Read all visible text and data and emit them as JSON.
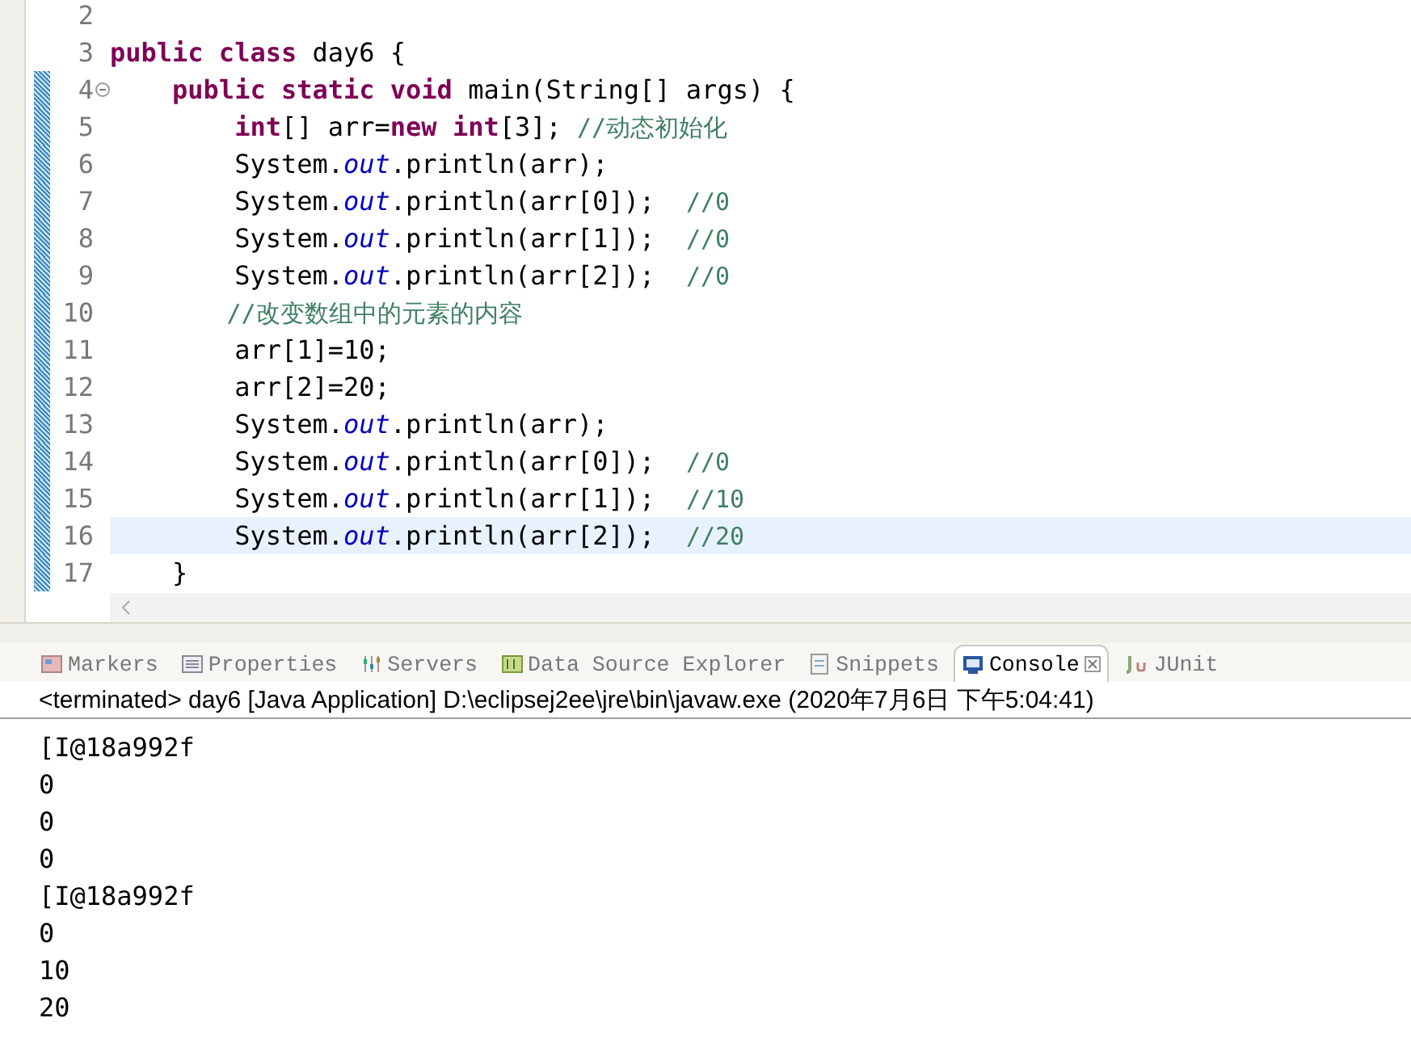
{
  "editor": {
    "lines": [
      {
        "number": "2",
        "changed": false,
        "current": false,
        "foldable": false
      },
      {
        "number": "3",
        "changed": false,
        "current": false,
        "foldable": false,
        "tokens": [
          {
            "text": "public class ",
            "kind": "keyword"
          },
          {
            "text": "day6 {",
            "kind": "plain"
          }
        ]
      },
      {
        "number": "4",
        "changed": true,
        "current": false,
        "foldable": true,
        "tokens": [
          {
            "text": "    public static void ",
            "kind": "keyword"
          },
          {
            "text": "main(String[] args) {",
            "kind": "plain"
          }
        ]
      },
      {
        "number": "5",
        "changed": true,
        "current": false,
        "foldable": false,
        "tokens": [
          {
            "text": "        int",
            "kind": "keyword"
          },
          {
            "text": "[] arr=",
            "kind": "plain"
          },
          {
            "text": "new int",
            "kind": "keyword"
          },
          {
            "text": "[3]; ",
            "kind": "plain"
          },
          {
            "text": "//动态初始化",
            "kind": "comment"
          }
        ]
      },
      {
        "number": "6",
        "changed": true,
        "current": false,
        "foldable": false,
        "tokens": [
          {
            "text": "        System.",
            "kind": "plain"
          },
          {
            "text": "out",
            "kind": "field"
          },
          {
            "text": ".println(arr);",
            "kind": "plain"
          }
        ]
      },
      {
        "number": "7",
        "changed": true,
        "current": false,
        "foldable": false,
        "tokens": [
          {
            "text": "        System.",
            "kind": "plain"
          },
          {
            "text": "out",
            "kind": "field"
          },
          {
            "text": ".println(arr[0]);  ",
            "kind": "plain"
          },
          {
            "text": "//0",
            "kind": "comment"
          }
        ]
      },
      {
        "number": "8",
        "changed": true,
        "current": false,
        "foldable": false,
        "tokens": [
          {
            "text": "        System.",
            "kind": "plain"
          },
          {
            "text": "out",
            "kind": "field"
          },
          {
            "text": ".println(arr[1]);  ",
            "kind": "plain"
          },
          {
            "text": "//0",
            "kind": "comment"
          }
        ]
      },
      {
        "number": "9",
        "changed": true,
        "current": false,
        "foldable": false,
        "tokens": [
          {
            "text": "        System.",
            "kind": "plain"
          },
          {
            "text": "out",
            "kind": "field"
          },
          {
            "text": ".println(arr[2]);  ",
            "kind": "plain"
          },
          {
            "text": "//0",
            "kind": "comment"
          }
        ]
      },
      {
        "number": "10",
        "changed": true,
        "current": false,
        "foldable": false,
        "tokens": [
          {
            "text": "        //改变数组中的元素的内容",
            "kind": "comment"
          }
        ]
      },
      {
        "number": "11",
        "changed": true,
        "current": false,
        "foldable": false,
        "tokens": [
          {
            "text": "        arr[1]=10;",
            "kind": "plain"
          }
        ]
      },
      {
        "number": "12",
        "changed": true,
        "current": false,
        "foldable": false,
        "tokens": [
          {
            "text": "        arr[2]=20;",
            "kind": "plain"
          }
        ]
      },
      {
        "number": "13",
        "changed": true,
        "current": false,
        "foldable": false,
        "tokens": [
          {
            "text": "        System.",
            "kind": "plain"
          },
          {
            "text": "out",
            "kind": "field"
          },
          {
            "text": ".println(arr);",
            "kind": "plain"
          }
        ]
      },
      {
        "number": "14",
        "changed": true,
        "current": false,
        "foldable": false,
        "tokens": [
          {
            "text": "        System.",
            "kind": "plain"
          },
          {
            "text": "out",
            "kind": "field"
          },
          {
            "text": ".println(arr[0]);  ",
            "kind": "plain"
          },
          {
            "text": "//0",
            "kind": "comment"
          }
        ]
      },
      {
        "number": "15",
        "changed": true,
        "current": false,
        "foldable": false,
        "tokens": [
          {
            "text": "        System.",
            "kind": "plain"
          },
          {
            "text": "out",
            "kind": "field"
          },
          {
            "text": ".println(arr[1]);  ",
            "kind": "plain"
          },
          {
            "text": "//10",
            "kind": "comment"
          }
        ]
      },
      {
        "number": "16",
        "changed": true,
        "current": true,
        "foldable": false,
        "tokens": [
          {
            "text": "        System.",
            "kind": "plain"
          },
          {
            "text": "out",
            "kind": "field"
          },
          {
            "text": ".println(arr[2]);  ",
            "kind": "plain"
          },
          {
            "text": "//20",
            "kind": "comment"
          }
        ]
      },
      {
        "number": "17",
        "changed": true,
        "current": false,
        "foldable": false,
        "tokens": [
          {
            "text": "    }",
            "kind": "plain"
          }
        ]
      }
    ]
  },
  "views": {
    "tabs": [
      {
        "label": "Markers",
        "kind": "markers",
        "selected": false
      },
      {
        "label": "Properties",
        "kind": "properties",
        "selected": false
      },
      {
        "label": "Servers",
        "kind": "servers",
        "selected": false
      },
      {
        "label": "Data Source Explorer",
        "kind": "datasource",
        "selected": false
      },
      {
        "label": "Snippets",
        "kind": "snippets",
        "selected": false
      },
      {
        "label": "Console",
        "kind": "console",
        "selected": true
      },
      {
        "label": "JUnit",
        "kind": "junit",
        "selected": false
      }
    ]
  },
  "console": {
    "header": "<terminated> day6 [Java Application] D:\\eclipsej2ee\\jre\\bin\\javaw.exe (2020年7月6日 下午5:04:41)",
    "output": [
      "[I@18a992f",
      "0",
      "0",
      "0",
      "[I@18a992f",
      "0",
      "10",
      "20"
    ]
  }
}
